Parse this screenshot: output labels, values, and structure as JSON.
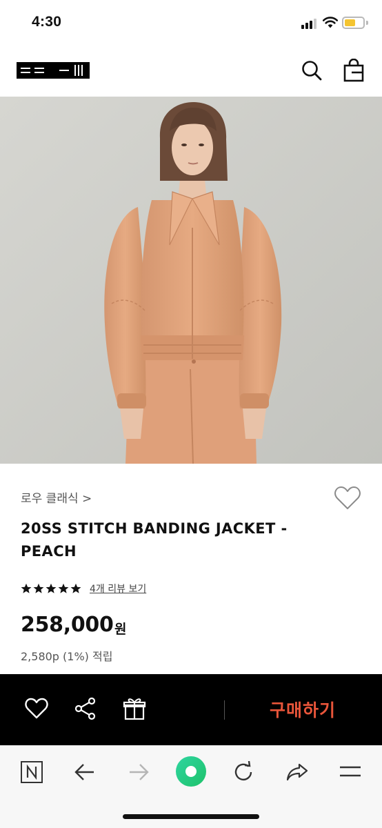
{
  "status_bar": {
    "time": "4:30"
  },
  "header": {
    "logo": "brand-logo",
    "icons": [
      "search-icon",
      "shopping-bag-icon"
    ]
  },
  "product": {
    "breadcrumb": "로우 클래식 >",
    "title": "20SS STITCH BANDING JACKET - PEACH",
    "rating_stars": 5,
    "review_link": "4개 리뷰 보기",
    "price": "258,000",
    "price_unit": "원",
    "points": "2,580p (1%) 적립"
  },
  "action_bar": {
    "icons": [
      "heart-icon",
      "share-icon",
      "gift-icon"
    ],
    "buy_label": "구매하기",
    "buy_color": "#e8553a"
  },
  "browser_toolbar": {
    "icons": [
      "naver-n-icon",
      "back-arrow-icon",
      "forward-arrow-icon",
      "green-home-icon",
      "reload-icon",
      "share-arrow-icon",
      "menu-icon"
    ]
  },
  "colors": {
    "hero_background": "#cdcdc8",
    "jacket": "#e0a27a",
    "accent_buy": "#e8553a",
    "battery": "#f4c430"
  }
}
